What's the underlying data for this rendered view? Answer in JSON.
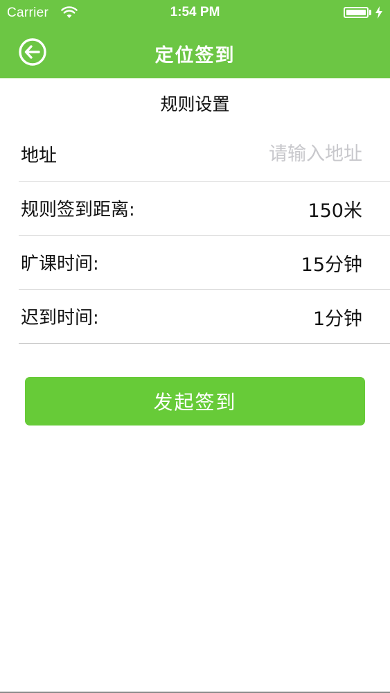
{
  "status_bar": {
    "carrier": "Carrier",
    "time": "1:54 PM",
    "battery_level": 1.0
  },
  "nav": {
    "title": "定位签到",
    "back_icon": "back-arrow-circle-icon"
  },
  "section": {
    "title": "规则设置"
  },
  "form": {
    "address": {
      "label": "地址",
      "value": "",
      "placeholder": "请输入地址"
    },
    "rows": [
      {
        "label": "规则签到距离:",
        "value": "150米"
      },
      {
        "label": "旷课时间:",
        "value": "15分钟"
      },
      {
        "label": "迟到时间:",
        "value": "1分钟"
      }
    ]
  },
  "actions": {
    "submit_label": "发起签到"
  },
  "colors": {
    "brand": "#6cc644",
    "button": "#67cb38",
    "placeholder": "#c8c8cc",
    "divider": "#d9d9d9"
  }
}
